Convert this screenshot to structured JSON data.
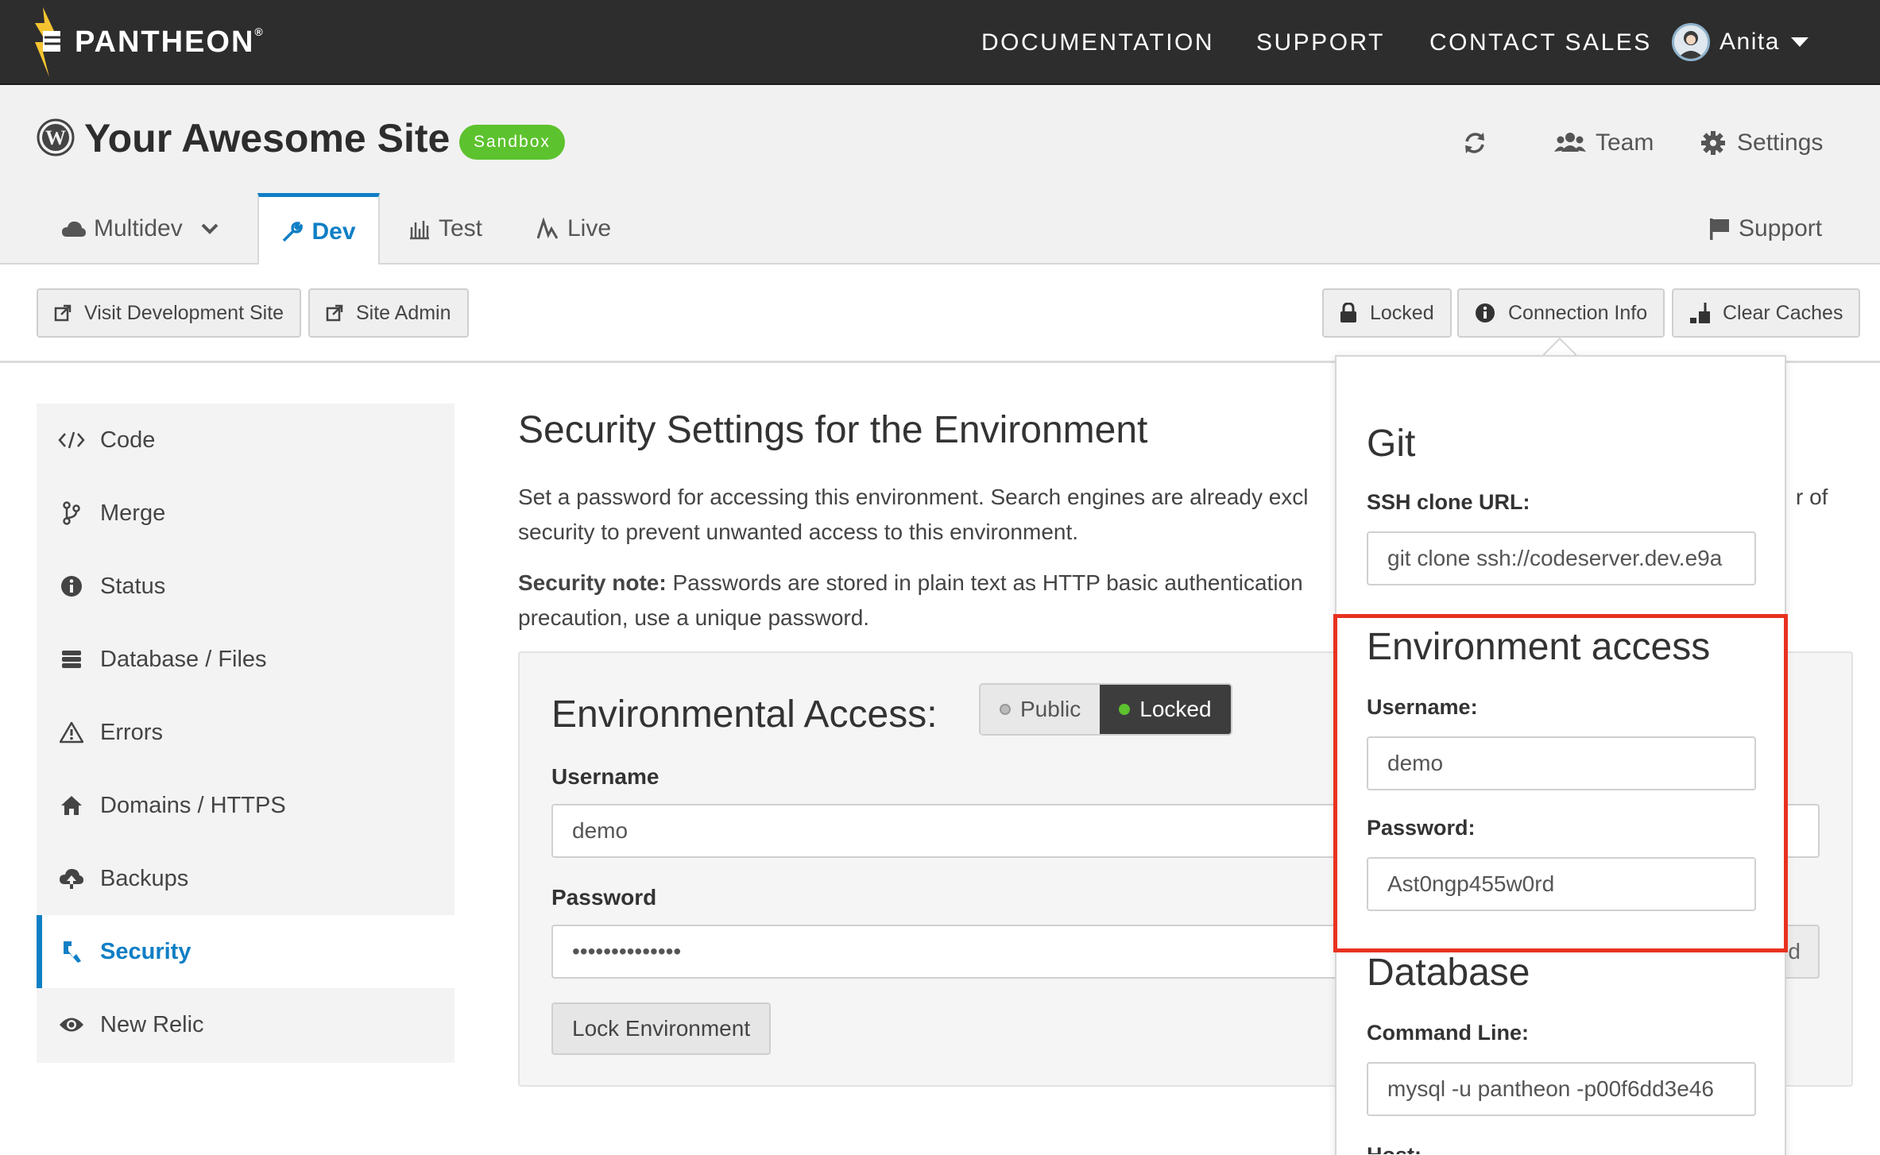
{
  "brand": {
    "name": "PANTHEON",
    "mark": "®"
  },
  "topnav": {
    "documentation": "DOCUMENTATION",
    "support": "SUPPORT",
    "contact_sales": "CONTACT SALES",
    "user_name": "Anita"
  },
  "site": {
    "title": "Your Awesome Site",
    "badge": "Sandbox",
    "team": "Team",
    "settings": "Settings"
  },
  "env_tabs": {
    "multidev": "Multidev",
    "dev": "Dev",
    "test": "Test",
    "live": "Live",
    "support": "Support"
  },
  "actions": {
    "visit_dev": "Visit Development Site",
    "site_admin": "Site Admin",
    "locked": "Locked",
    "connection_info": "Connection Info",
    "clear_caches": "Clear Caches"
  },
  "sidebar": {
    "items": [
      {
        "label": "Code",
        "icon": "code-icon"
      },
      {
        "label": "Merge",
        "icon": "branch-icon"
      },
      {
        "label": "Status",
        "icon": "info-icon"
      },
      {
        "label": "Database / Files",
        "icon": "database-icon"
      },
      {
        "label": "Errors",
        "icon": "warning-icon"
      },
      {
        "label": "Domains / HTTPS",
        "icon": "home-icon"
      },
      {
        "label": "Backups",
        "icon": "cloud-upload-icon"
      },
      {
        "label": "Security",
        "icon": "key-icon"
      },
      {
        "label": "New Relic",
        "icon": "eye-icon"
      }
    ]
  },
  "main": {
    "title": "Security Settings for the Environment",
    "desc_line1": "Set a password for accessing this environment. Search engines are already excl",
    "desc_line1_tail": "r of",
    "desc_line2": "security to prevent unwanted access to this environment.",
    "note_label": "Security note:",
    "note_line1": " Passwords are stored in plain text as HTTP basic authentication",
    "note_line2": "precaution, use a unique password."
  },
  "access_panel": {
    "title": "Environmental Access:",
    "toggle_public": "Public",
    "toggle_locked": "Locked",
    "username_label": "Username",
    "username_value": "demo",
    "password_label": "Password",
    "password_value": "••••••••••••••",
    "password_btn_tail": "d",
    "lock_button": "Lock Environment"
  },
  "connection_popover": {
    "git_heading": "Git",
    "ssh_label": "SSH clone URL:",
    "ssh_value": "git clone ssh://codeserver.dev.e9a",
    "env_heading": "Environment access",
    "username_label": "Username:",
    "username_value": "demo",
    "password_label": "Password:",
    "password_value": "Ast0ngp455w0rd",
    "db_heading": "Database",
    "cmd_label": "Command Line:",
    "cmd_value": "mysql -u pantheon -p00f6dd3e46",
    "host_label": "Host:"
  },
  "colors": {
    "accent": "#0f7fc5",
    "badge": "#5cc22d",
    "highlight": "#e8321f",
    "topbar": "#2d2d2d"
  }
}
